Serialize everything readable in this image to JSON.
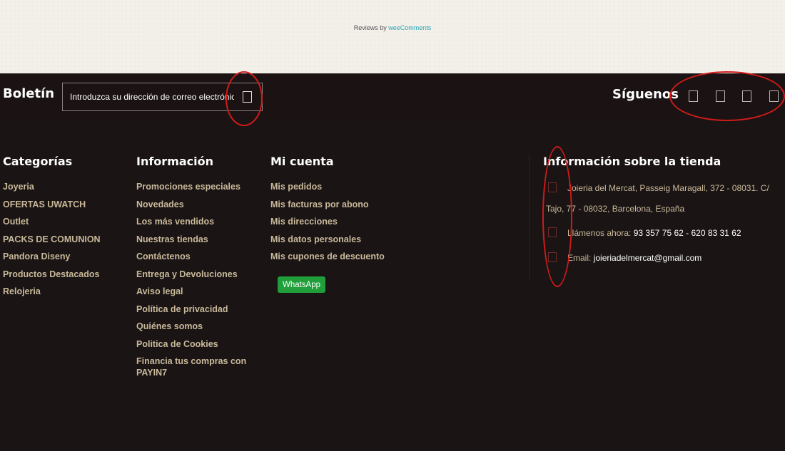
{
  "reviews": {
    "prefix": "Reviews by ",
    "link": "weeComments"
  },
  "newsletter": {
    "title": "Boletín",
    "placeholder": "Introduzca su dirección de correo electrónico",
    "submit_icon": "envelope-icon"
  },
  "follow": {
    "title": "Síguenos",
    "icons": [
      "facebook-icon",
      "twitter-icon",
      "youtube-icon",
      "instagram-icon"
    ]
  },
  "columns": {
    "categorias": {
      "title": "Categorías",
      "items": [
        "Joyeria",
        "OFERTAS UWATCH",
        "Outlet",
        "PACKS DE COMUNION",
        "Pandora Diseny",
        "Productos Destacados",
        "Relojeria"
      ]
    },
    "informacion": {
      "title": "Información",
      "items": [
        "Promociones especiales",
        "Novedades",
        "Los más vendidos",
        "Nuestras tiendas",
        "Contáctenos",
        "Entrega y Devoluciones",
        "Aviso legal",
        "Política de privacidad",
        "Quiénes somos",
        "Politica de Cookies",
        "Financia tus compras con PAYIN7"
      ]
    },
    "cuenta": {
      "title": "Mi cuenta",
      "items": [
        "Mis pedidos",
        "Mis facturas por abono",
        "Mis direcciones",
        "Mis datos personales",
        "Mis cupones de descuento"
      ],
      "whatsapp": "WhatsApp"
    },
    "tienda": {
      "title": "Información sobre la tienda",
      "address_line1": "Joieria del Mercat, Passeig Maragall, 372 - 08031. C/",
      "address_line2": "Tajo, 77 - 08032, Barcelona, España",
      "phone_label": "Llámenos ahora: ",
      "phone_value": "93 357 75 62 - 620 83 31 62",
      "email_label": "Email: ",
      "email_value": "joieriadelmercat@gmail.com",
      "icons": [
        "map-marker-icon",
        "phone-icon",
        "envelope-icon"
      ]
    }
  },
  "colors": {
    "footer_bg": "#1a1414",
    "link": "#c9b99a",
    "annotation": "#d11a1a",
    "whatsapp": "#1f9e3a"
  }
}
